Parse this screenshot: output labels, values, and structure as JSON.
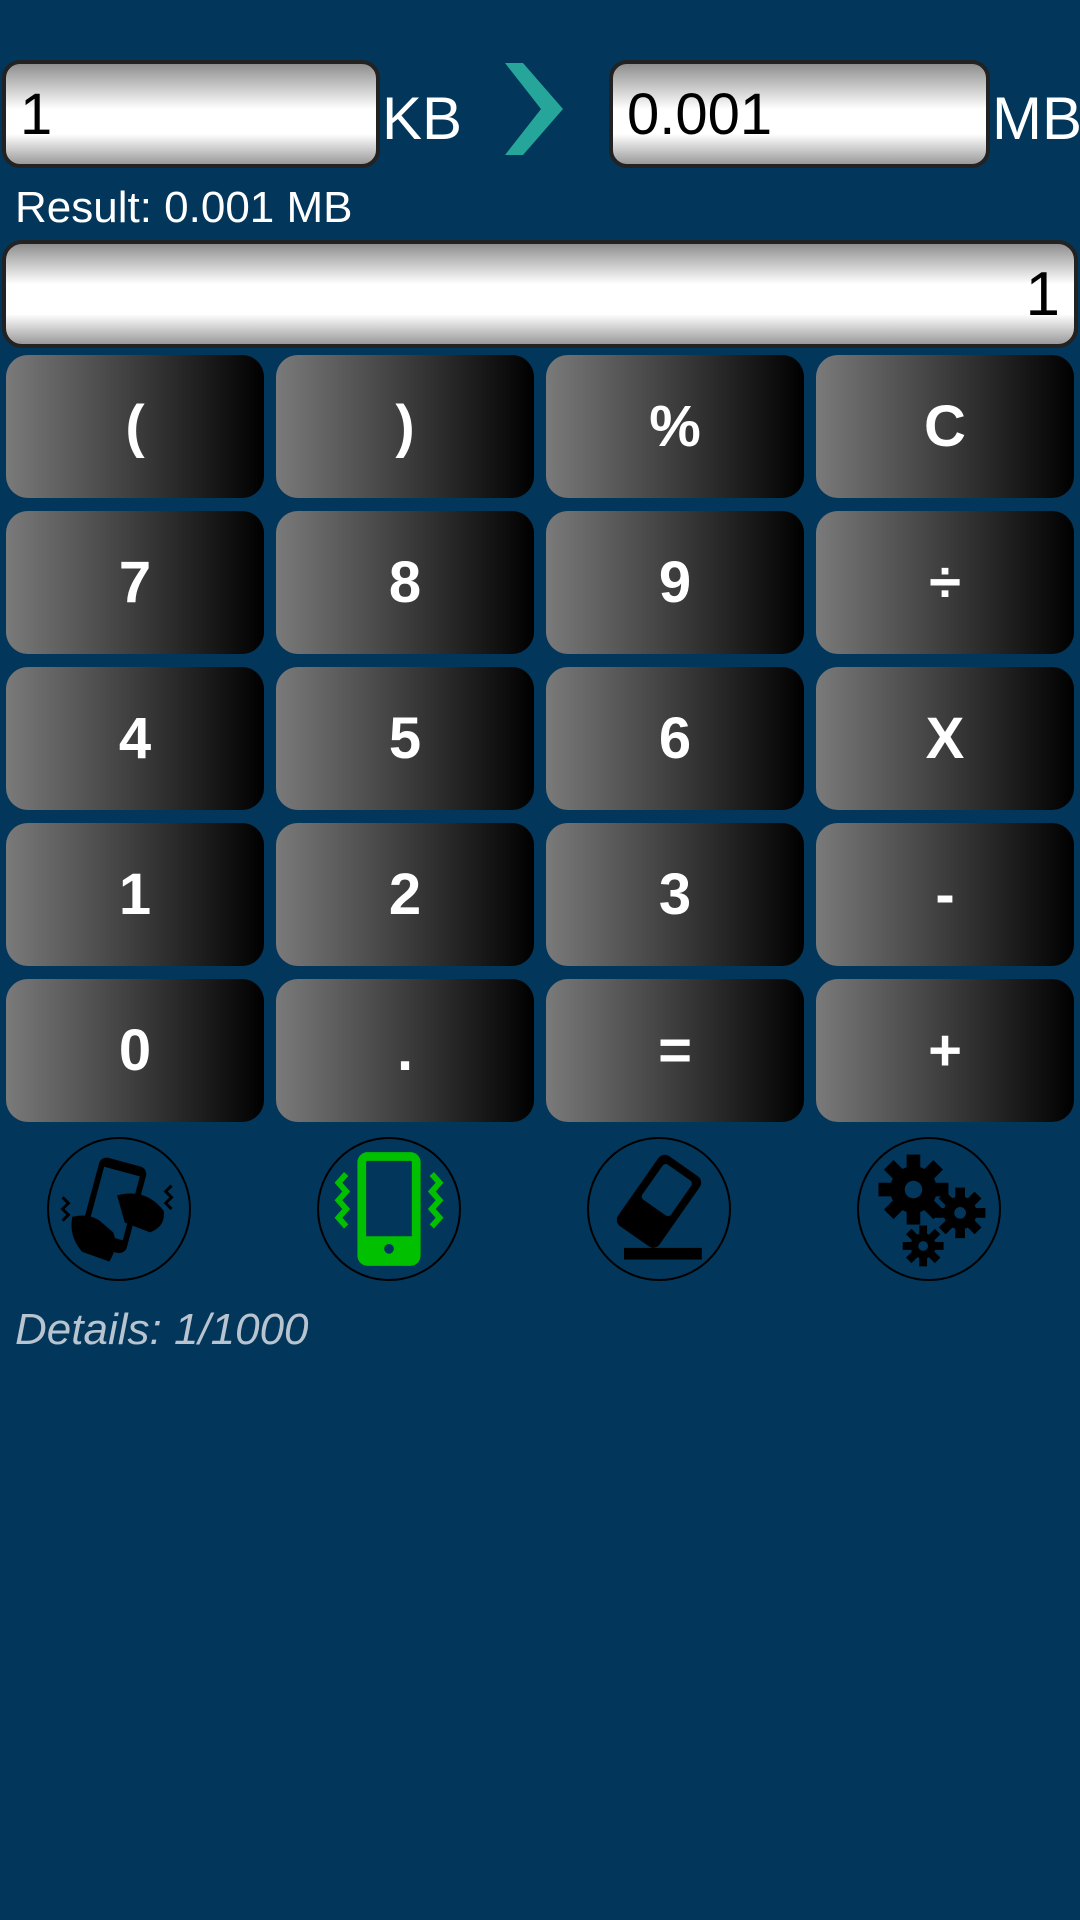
{
  "converter": {
    "from_value": "1",
    "from_unit": "KB",
    "to_value": "0.001",
    "to_unit": "MB",
    "accent_color": "#26a69a"
  },
  "result_text": "Result: 0.001 MB",
  "display_value": "1",
  "keypad": {
    "row1": [
      "(",
      ")",
      "%",
      "C"
    ],
    "row2": [
      "7",
      "8",
      "9",
      "÷"
    ],
    "row3": [
      "4",
      "5",
      "6",
      "X"
    ],
    "row4": [
      "1",
      "2",
      "3",
      "-"
    ],
    "row5": [
      "0",
      ".",
      "=",
      "+"
    ]
  },
  "tools": {
    "shake": "shake-phone-icon",
    "vibrate": "vibrate-phone-icon",
    "eraser": "eraser-icon",
    "settings": "gears-icon",
    "vibrate_color": "#00c000"
  },
  "details_text": "Details: 1/1000"
}
